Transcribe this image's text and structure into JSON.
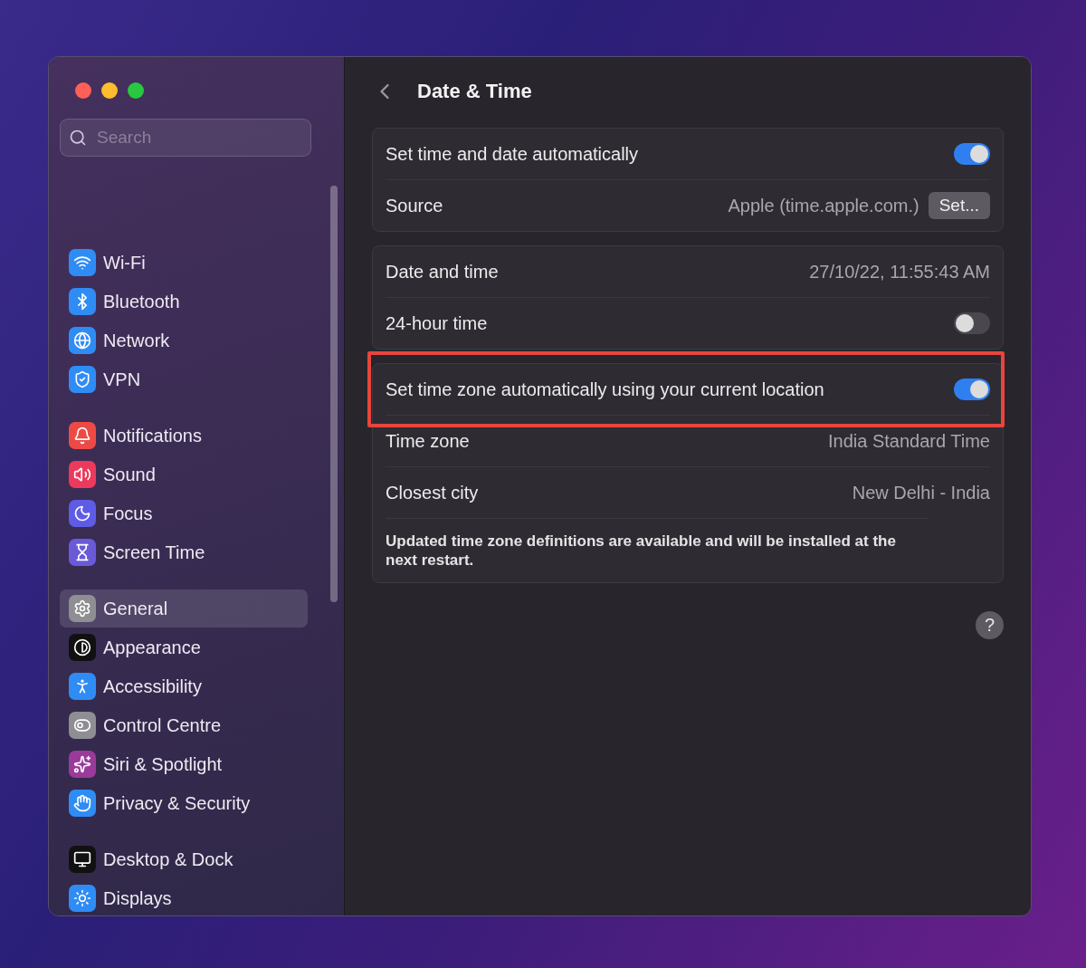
{
  "window": {
    "title": "Date & Time"
  },
  "search": {
    "placeholder": "Search"
  },
  "sidebar": {
    "groups": [
      {
        "items": [
          {
            "label": "Wi-Fi",
            "color": "#2f8cf5",
            "selected": false
          },
          {
            "label": "Bluetooth",
            "color": "#2f8cf5",
            "selected": false
          },
          {
            "label": "Network",
            "color": "#2f8cf5",
            "selected": false
          },
          {
            "label": "VPN",
            "color": "#2f8cf5",
            "selected": false
          }
        ]
      },
      {
        "items": [
          {
            "label": "Notifications",
            "color": "#ee4a45",
            "selected": false
          },
          {
            "label": "Sound",
            "color": "#ec3a5c",
            "selected": false
          },
          {
            "label": "Focus",
            "color": "#5e5ce6",
            "selected": false
          },
          {
            "label": "Screen Time",
            "color": "#6a5ad8",
            "selected": false
          }
        ]
      },
      {
        "items": [
          {
            "label": "General",
            "color": "#8e8e93",
            "selected": true
          },
          {
            "label": "Appearance",
            "color": "#111111",
            "selected": false
          },
          {
            "label": "Accessibility",
            "color": "#2f8cf5",
            "selected": false
          },
          {
            "label": "Control Centre",
            "color": "#8e8e93",
            "selected": false
          },
          {
            "label": "Siri & Spotlight",
            "color": "#9a3a9a",
            "selected": false
          },
          {
            "label": "Privacy & Security",
            "color": "#2f8cf5",
            "selected": false
          }
        ]
      },
      {
        "items": [
          {
            "label": "Desktop & Dock",
            "color": "#111111",
            "selected": false
          },
          {
            "label": "Displays",
            "color": "#2f8cf5",
            "selected": false
          }
        ]
      }
    ]
  },
  "cards": [
    {
      "rows": [
        {
          "kind": "toggle",
          "label": "Set time and date automatically",
          "on": true,
          "highlighted": false
        },
        {
          "kind": "value_button",
          "label": "Source",
          "value": "Apple (time.apple.com.)",
          "button": "Set..."
        }
      ]
    },
    {
      "rows": [
        {
          "kind": "value",
          "label": "Date and time",
          "value": "27/10/22, 11:55:43 AM"
        },
        {
          "kind": "toggle",
          "label": "24-hour time",
          "on": false,
          "highlighted": false
        }
      ]
    },
    {
      "rows": [
        {
          "kind": "toggle",
          "label": "Set time zone automatically using your current location",
          "on": true,
          "highlighted": true
        },
        {
          "kind": "value",
          "label": "Time zone",
          "value": "India Standard Time"
        },
        {
          "kind": "value",
          "label": "Closest city",
          "value": "New Delhi - India"
        },
        {
          "kind": "note",
          "text": "Updated time zone definitions are available and will be installed at the next restart."
        }
      ]
    }
  ],
  "help": {
    "label": "?"
  }
}
